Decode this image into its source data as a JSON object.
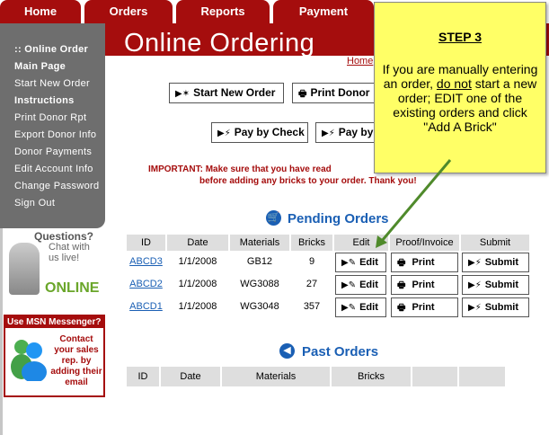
{
  "nav": {
    "tabs": [
      {
        "label": "Home"
      },
      {
        "label": "Orders"
      },
      {
        "label": "Reports"
      },
      {
        "label": "Payment"
      }
    ]
  },
  "sidebar": {
    "items": [
      {
        "label": ":: Online Order",
        "bold": true
      },
      {
        "label": "Main Page",
        "bold": true
      },
      {
        "label": "Start New Order",
        "bold": false
      },
      {
        "label": "Instructions",
        "bold": true
      },
      {
        "label": "Print Donor Rpt",
        "bold": false
      },
      {
        "label": "Export Donor Info",
        "bold": false
      },
      {
        "label": "Donor Payments",
        "bold": false
      },
      {
        "label": "Edit Account Info",
        "bold": false
      },
      {
        "label": "Change Password",
        "bold": false
      },
      {
        "label": "Sign Out",
        "bold": false
      }
    ]
  },
  "header": {
    "title": "Online Ordering",
    "home_link": "Home"
  },
  "chat_ad": {
    "question": "Questions?",
    "line1": "Chat with",
    "line2": "us live!",
    "status": "ONLINE"
  },
  "msn_ad": {
    "heading": "Use MSN Messenger?",
    "body": "Contact your sales rep. by adding their email"
  },
  "actions": {
    "start_new_order": "Start New Order",
    "print_donor": "Print Donor",
    "pay_by_check": "Pay by Check",
    "pay_by": "Pay by"
  },
  "notice": {
    "line1": "IMPORTANT:  Make sure that you have read",
    "line2": "before adding any bricks to your order. Thank you!"
  },
  "pending": {
    "heading": "Pending Orders",
    "columns": [
      "ID",
      "Date",
      "Materials",
      "Bricks",
      "Edit",
      "Proof/Invoice",
      "Submit"
    ],
    "rows": [
      {
        "id": "ABCD3",
        "date": "1/1/2008",
        "materials": "GB12",
        "bricks": "9"
      },
      {
        "id": "ABCD2",
        "date": "1/1/2008",
        "materials": "WG3088",
        "bricks": "27"
      },
      {
        "id": "ABCD1",
        "date": "1/1/2008",
        "materials": "WG3048",
        "bricks": "357"
      }
    ],
    "edit_label": "Edit",
    "print_label": "Print",
    "submit_label": "Submit"
  },
  "past": {
    "heading": "Past Orders",
    "columns": [
      "ID",
      "Date",
      "Materials",
      "Bricks"
    ]
  },
  "callout": {
    "title": "STEP 3",
    "text_before": "If you are manually entering an order,",
    "text_underlined": "do not",
    "text_after": "start a new order; EDIT one of the existing orders and click \"Add A Brick\""
  }
}
